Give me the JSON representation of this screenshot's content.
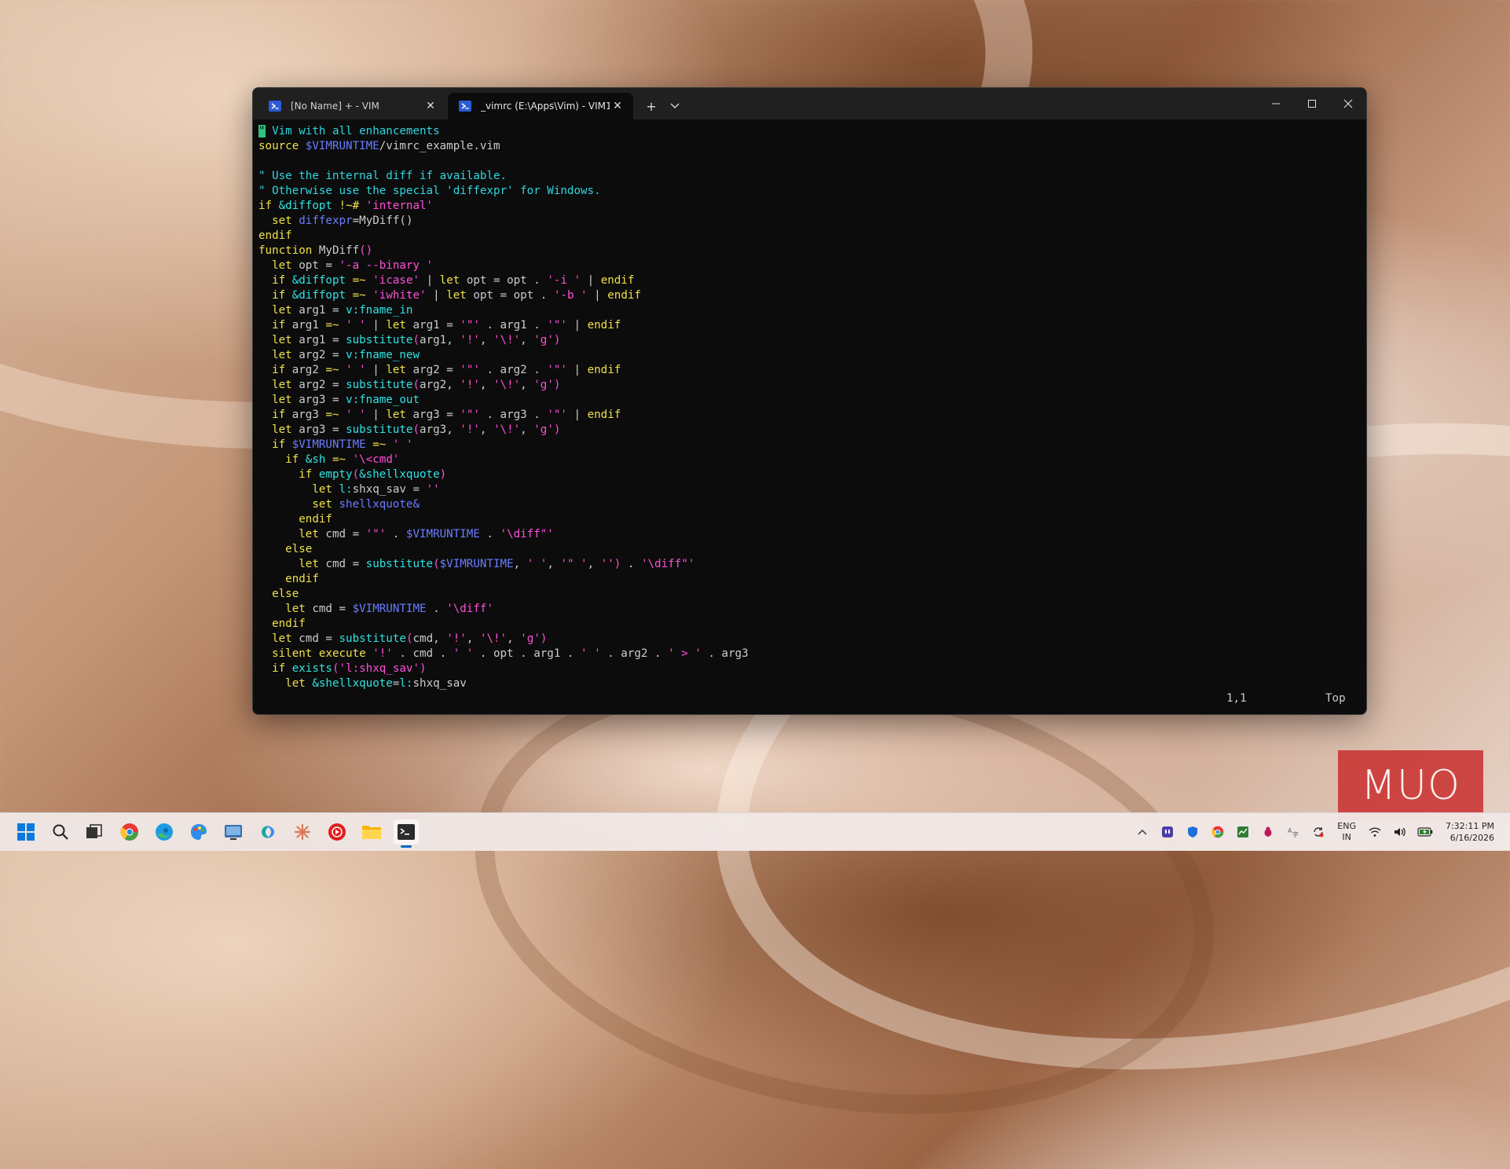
{
  "window": {
    "tabs": [
      {
        "label": "[No Name] + - VIM",
        "active": false
      },
      {
        "label": "_vimrc (E:\\Apps\\Vim) - VIM1",
        "active": true
      }
    ],
    "new_tab_symbol": "+",
    "dropdown_symbol": "⌄"
  },
  "editor": {
    "lines": [
      [
        [
          "c",
          "\" Vim with all enhancements"
        ]
      ],
      [
        [
          "k",
          "source "
        ],
        [
          "o",
          "$VIMRUNTIME"
        ],
        [
          "v",
          "/vimrc_example.vim"
        ]
      ],
      [
        [
          "v",
          ""
        ]
      ],
      [
        [
          "c",
          "\" Use the internal diff if available."
        ]
      ],
      [
        [
          "c",
          "\" Otherwise use the special 'diffexpr' for Windows."
        ]
      ],
      [
        [
          "k",
          "if "
        ],
        [
          "f",
          "&diffopt"
        ],
        [
          "v",
          " "
        ],
        [
          "k",
          "!~#"
        ],
        [
          "v",
          " "
        ],
        [
          "s",
          "'internal'"
        ]
      ],
      [
        [
          "v",
          "  "
        ],
        [
          "k",
          "set "
        ],
        [
          "o",
          "diffexpr"
        ],
        [
          "v",
          "=MyDiff()"
        ]
      ],
      [
        [
          "k",
          "endif"
        ]
      ],
      [
        [
          "k",
          "function "
        ],
        [
          "v",
          "MyDiff"
        ],
        [
          "s",
          "()"
        ]
      ],
      [
        [
          "v",
          "  "
        ],
        [
          "k",
          "let "
        ],
        [
          "v",
          "opt = "
        ],
        [
          "s",
          "'-a --binary '"
        ]
      ],
      [
        [
          "v",
          "  "
        ],
        [
          "k",
          "if "
        ],
        [
          "f",
          "&diffopt"
        ],
        [
          "v",
          " "
        ],
        [
          "k",
          "=~"
        ],
        [
          "v",
          " "
        ],
        [
          "s",
          "'icase'"
        ],
        [
          "v",
          " | "
        ],
        [
          "k",
          "let "
        ],
        [
          "v",
          "opt = opt . "
        ],
        [
          "s",
          "'-i '"
        ],
        [
          "v",
          " | "
        ],
        [
          "k",
          "endif"
        ]
      ],
      [
        [
          "v",
          "  "
        ],
        [
          "k",
          "if "
        ],
        [
          "f",
          "&diffopt"
        ],
        [
          "v",
          " "
        ],
        [
          "k",
          "=~"
        ],
        [
          "v",
          " "
        ],
        [
          "s",
          "'iwhite'"
        ],
        [
          "v",
          " | "
        ],
        [
          "k",
          "let "
        ],
        [
          "v",
          "opt = opt . "
        ],
        [
          "s",
          "'-b '"
        ],
        [
          "v",
          " | "
        ],
        [
          "k",
          "endif"
        ]
      ],
      [
        [
          "v",
          "  "
        ],
        [
          "k",
          "let "
        ],
        [
          "v",
          "arg1 = "
        ],
        [
          "f",
          "v:fname_in"
        ]
      ],
      [
        [
          "v",
          "  "
        ],
        [
          "k",
          "if "
        ],
        [
          "v",
          "arg1 "
        ],
        [
          "k",
          "=~"
        ],
        [
          "v",
          " "
        ],
        [
          "s",
          "' '"
        ],
        [
          "v",
          " | "
        ],
        [
          "k",
          "let "
        ],
        [
          "v",
          "arg1 = "
        ],
        [
          "s",
          "'\"'"
        ],
        [
          "v",
          " . arg1 . "
        ],
        [
          "s",
          "'\"'"
        ],
        [
          "v",
          " | "
        ],
        [
          "k",
          "endif"
        ]
      ],
      [
        [
          "v",
          "  "
        ],
        [
          "k",
          "let "
        ],
        [
          "v",
          "arg1 = "
        ],
        [
          "f",
          "substitute"
        ],
        [
          "s",
          "("
        ],
        [
          "v",
          "arg1, "
        ],
        [
          "s",
          "'!'"
        ],
        [
          "v",
          ", "
        ],
        [
          "s",
          "'\\!'"
        ],
        [
          "v",
          ", "
        ],
        [
          "s",
          "'g'"
        ],
        [
          "s",
          ")"
        ]
      ],
      [
        [
          "v",
          "  "
        ],
        [
          "k",
          "let "
        ],
        [
          "v",
          "arg2 = "
        ],
        [
          "f",
          "v:fname_new"
        ]
      ],
      [
        [
          "v",
          "  "
        ],
        [
          "k",
          "if "
        ],
        [
          "v",
          "arg2 "
        ],
        [
          "k",
          "=~"
        ],
        [
          "v",
          " "
        ],
        [
          "s",
          "' '"
        ],
        [
          "v",
          " | "
        ],
        [
          "k",
          "let "
        ],
        [
          "v",
          "arg2 = "
        ],
        [
          "s",
          "'\"'"
        ],
        [
          "v",
          " . arg2 . "
        ],
        [
          "s",
          "'\"'"
        ],
        [
          "v",
          " | "
        ],
        [
          "k",
          "endif"
        ]
      ],
      [
        [
          "v",
          "  "
        ],
        [
          "k",
          "let "
        ],
        [
          "v",
          "arg2 = "
        ],
        [
          "f",
          "substitute"
        ],
        [
          "s",
          "("
        ],
        [
          "v",
          "arg2, "
        ],
        [
          "s",
          "'!'"
        ],
        [
          "v",
          ", "
        ],
        [
          "s",
          "'\\!'"
        ],
        [
          "v",
          ", "
        ],
        [
          "s",
          "'g'"
        ],
        [
          "s",
          ")"
        ]
      ],
      [
        [
          "v",
          "  "
        ],
        [
          "k",
          "let "
        ],
        [
          "v",
          "arg3 = "
        ],
        [
          "f",
          "v:fname_out"
        ]
      ],
      [
        [
          "v",
          "  "
        ],
        [
          "k",
          "if "
        ],
        [
          "v",
          "arg3 "
        ],
        [
          "k",
          "=~"
        ],
        [
          "v",
          " "
        ],
        [
          "s",
          "' '"
        ],
        [
          "v",
          " | "
        ],
        [
          "k",
          "let "
        ],
        [
          "v",
          "arg3 = "
        ],
        [
          "s",
          "'\"'"
        ],
        [
          "v",
          " . arg3 . "
        ],
        [
          "s",
          "'\"'"
        ],
        [
          "v",
          " | "
        ],
        [
          "k",
          "endif"
        ]
      ],
      [
        [
          "v",
          "  "
        ],
        [
          "k",
          "let "
        ],
        [
          "v",
          "arg3 = "
        ],
        [
          "f",
          "substitute"
        ],
        [
          "s",
          "("
        ],
        [
          "v",
          "arg3, "
        ],
        [
          "s",
          "'!'"
        ],
        [
          "v",
          ", "
        ],
        [
          "s",
          "'\\!'"
        ],
        [
          "v",
          ", "
        ],
        [
          "s",
          "'g'"
        ],
        [
          "s",
          ")"
        ]
      ],
      [
        [
          "v",
          "  "
        ],
        [
          "k",
          "if "
        ],
        [
          "o",
          "$VIMRUNTIME"
        ],
        [
          "v",
          " "
        ],
        [
          "k",
          "=~"
        ],
        [
          "v",
          " "
        ],
        [
          "s",
          "' '"
        ]
      ],
      [
        [
          "v",
          "    "
        ],
        [
          "k",
          "if "
        ],
        [
          "f",
          "&sh"
        ],
        [
          "v",
          " "
        ],
        [
          "k",
          "=~"
        ],
        [
          "v",
          " "
        ],
        [
          "s",
          "'\\<cmd'"
        ]
      ],
      [
        [
          "v",
          "      "
        ],
        [
          "k",
          "if "
        ],
        [
          "f",
          "empty"
        ],
        [
          "s",
          "("
        ],
        [
          "f",
          "&shellxquote"
        ],
        [
          "s",
          ")"
        ]
      ],
      [
        [
          "v",
          "        "
        ],
        [
          "k",
          "let "
        ],
        [
          "f",
          "l:"
        ],
        [
          "v",
          "shxq_sav = "
        ],
        [
          "s",
          "''"
        ]
      ],
      [
        [
          "v",
          "        "
        ],
        [
          "k",
          "set "
        ],
        [
          "o",
          "shellxquote&"
        ]
      ],
      [
        [
          "v",
          "      "
        ],
        [
          "k",
          "endif"
        ]
      ],
      [
        [
          "v",
          "      "
        ],
        [
          "k",
          "let "
        ],
        [
          "v",
          "cmd = "
        ],
        [
          "s",
          "'\"'"
        ],
        [
          "v",
          " . "
        ],
        [
          "o",
          "$VIMRUNTIME"
        ],
        [
          "v",
          " . "
        ],
        [
          "s",
          "'\\diff\"'"
        ]
      ],
      [
        [
          "v",
          "    "
        ],
        [
          "k",
          "else"
        ]
      ],
      [
        [
          "v",
          "      "
        ],
        [
          "k",
          "let "
        ],
        [
          "v",
          "cmd = "
        ],
        [
          "f",
          "substitute"
        ],
        [
          "s",
          "("
        ],
        [
          "o",
          "$VIMRUNTIME"
        ],
        [
          "v",
          ", "
        ],
        [
          "s",
          "' '"
        ],
        [
          "v",
          ", "
        ],
        [
          "s",
          "'\" '"
        ],
        [
          "v",
          ", "
        ],
        [
          "s",
          "''"
        ],
        [
          "s",
          ")"
        ],
        [
          "v",
          " . "
        ],
        [
          "s",
          "'\\diff\"'"
        ]
      ],
      [
        [
          "v",
          "    "
        ],
        [
          "k",
          "endif"
        ]
      ],
      [
        [
          "v",
          "  "
        ],
        [
          "k",
          "else"
        ]
      ],
      [
        [
          "v",
          "    "
        ],
        [
          "k",
          "let "
        ],
        [
          "v",
          "cmd = "
        ],
        [
          "o",
          "$VIMRUNTIME"
        ],
        [
          "v",
          " . "
        ],
        [
          "s",
          "'\\diff'"
        ]
      ],
      [
        [
          "v",
          "  "
        ],
        [
          "k",
          "endif"
        ]
      ],
      [
        [
          "v",
          "  "
        ],
        [
          "k",
          "let "
        ],
        [
          "v",
          "cmd = "
        ],
        [
          "f",
          "substitute"
        ],
        [
          "s",
          "("
        ],
        [
          "v",
          "cmd, "
        ],
        [
          "s",
          "'!'"
        ],
        [
          "v",
          ", "
        ],
        [
          "s",
          "'\\!'"
        ],
        [
          "v",
          ", "
        ],
        [
          "s",
          "'g'"
        ],
        [
          "s",
          ")"
        ]
      ],
      [
        [
          "v",
          "  "
        ],
        [
          "k",
          "silent execute "
        ],
        [
          "s",
          "'!'"
        ],
        [
          "v",
          " . cmd . "
        ],
        [
          "s",
          "' '"
        ],
        [
          "v",
          " . opt . arg1 . "
        ],
        [
          "s",
          "' '"
        ],
        [
          "v",
          " . arg2 . "
        ],
        [
          "s",
          "' > '"
        ],
        [
          "v",
          " . arg3"
        ]
      ],
      [
        [
          "v",
          "  "
        ],
        [
          "k",
          "if "
        ],
        [
          "f",
          "exists"
        ],
        [
          "s",
          "("
        ],
        [
          "s",
          "'l:shxq_sav'"
        ],
        [
          "s",
          ")"
        ]
      ],
      [
        [
          "v",
          "    "
        ],
        [
          "k",
          "let "
        ],
        [
          "f",
          "&shellxquote"
        ],
        [
          "v",
          "="
        ],
        [
          "f",
          "l:"
        ],
        [
          "v",
          "shxq_sav"
        ]
      ]
    ],
    "status": {
      "position": "1,1",
      "scroll": "Top"
    }
  },
  "watermark": {
    "text": "MUO"
  },
  "taskbar": {
    "icons": [
      "windows-start-icon",
      "search-icon",
      "task-view-icon",
      "chrome-icon",
      "edge-icon",
      "paint-icon",
      "settings-icon",
      "copilot-icon",
      "claude-icon",
      "youtube-music-icon",
      "file-explorer-icon",
      "terminal-icon"
    ],
    "tray": {
      "lang_top": "ENG",
      "lang_bottom": "IN",
      "time": "7:32:11 PM",
      "date": "6/16/2026"
    }
  }
}
